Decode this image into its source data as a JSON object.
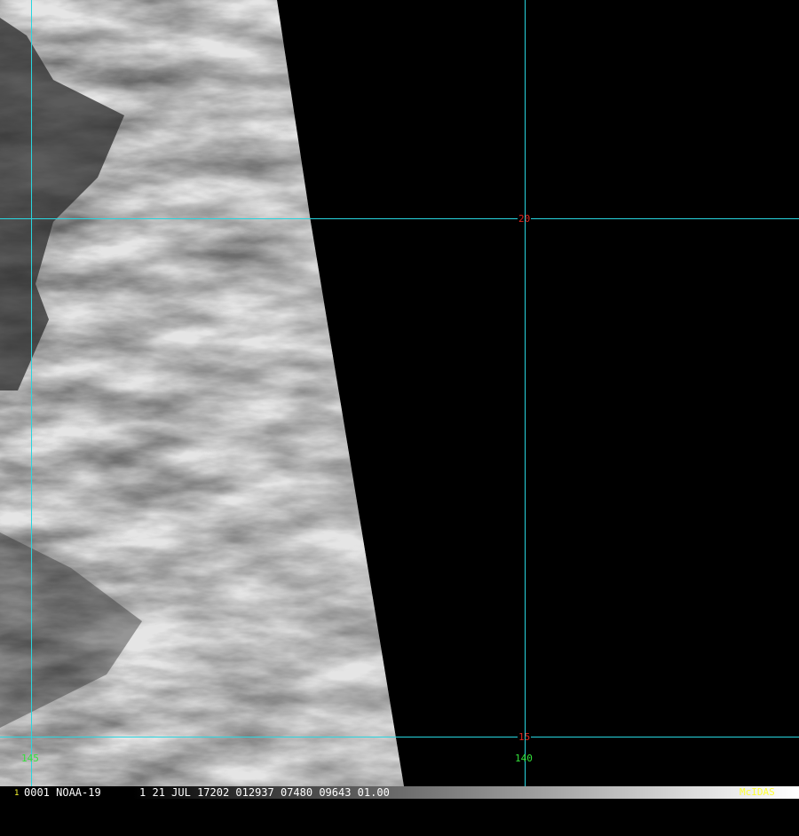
{
  "colors": {
    "grid": "#28d6e0",
    "lat_label": "#e0241c",
    "lon_label": "#33e23a",
    "brand": "#ffff33",
    "frame_number": "#ffff33"
  },
  "grid": {
    "latitudes": [
      {
        "value": 20,
        "label": "20"
      },
      {
        "value": 15,
        "label": "15"
      }
    ],
    "longitudes": [
      {
        "value": 145,
        "label": "145"
      },
      {
        "value": 140,
        "label": "140"
      }
    ]
  },
  "status_bar": {
    "frame_number": "1",
    "text": "0001 NOAA-19      1 21 JUL 17202 012937 07480 09643 01.00",
    "brand": "McIDAS"
  }
}
